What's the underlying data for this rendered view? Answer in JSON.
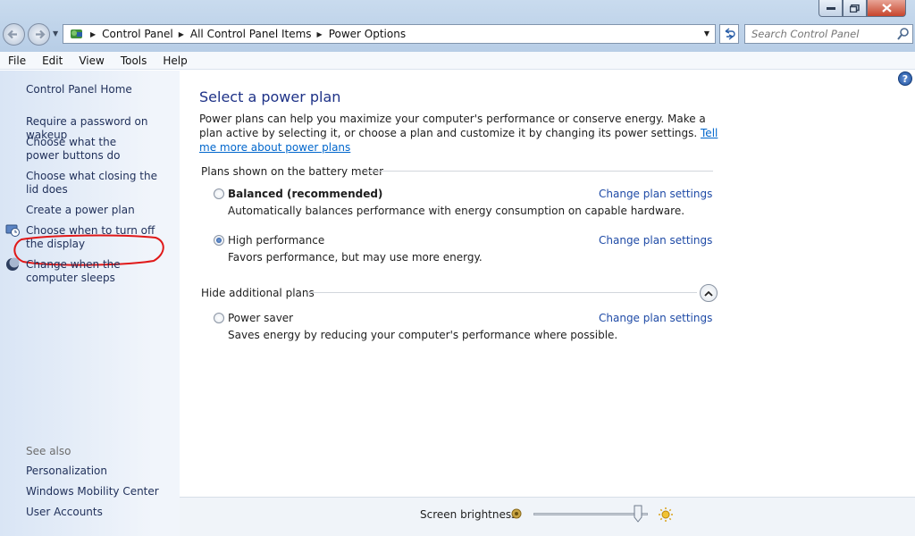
{
  "address": {
    "crumbs": [
      "Control Panel",
      "All Control Panel Items",
      "Power Options"
    ]
  },
  "search": {
    "placeholder": "Search Control Panel"
  },
  "menu": [
    "File",
    "Edit",
    "View",
    "Tools",
    "Help"
  ],
  "sidebar": {
    "home": "Control Panel Home",
    "links": [
      "Require a password on wakeup",
      "Choose what the power buttons do",
      "Choose what closing the lid does",
      "Create a power plan",
      "Choose when to turn off the display",
      "Change when the computer sleeps"
    ],
    "see_also_label": "See also",
    "see_also": [
      "Personalization",
      "Windows Mobility Center",
      "User Accounts"
    ]
  },
  "main": {
    "title": "Select a power plan",
    "intro": "Power plans can help you maximize your computer's performance or conserve energy. Make a plan active by selecting it, or choose a plan and customize it by changing its power settings.",
    "intro_link": "Tell me more about power plans",
    "battery_group": "Plans shown on the battery meter",
    "plans": [
      {
        "name": "Balanced (recommended)",
        "desc": "Automatically balances performance with energy consumption on capable hardware.",
        "link": "Change plan settings",
        "selected": false
      },
      {
        "name": "High performance",
        "desc": "Favors performance, but may use more energy.",
        "link": "Change plan settings",
        "selected": true
      }
    ],
    "additional_group": "Hide additional plans",
    "additional_plans": [
      {
        "name": "Power saver",
        "desc": "Saves energy by reducing your computer's performance where possible.",
        "link": "Change plan settings",
        "selected": false
      }
    ]
  },
  "bottom": {
    "brightness_label": "Screen brightness:",
    "brightness_level": 0.95
  },
  "colors": {
    "link": "#1e4aa6",
    "title": "#1e3287",
    "annotation": "#e01818"
  }
}
